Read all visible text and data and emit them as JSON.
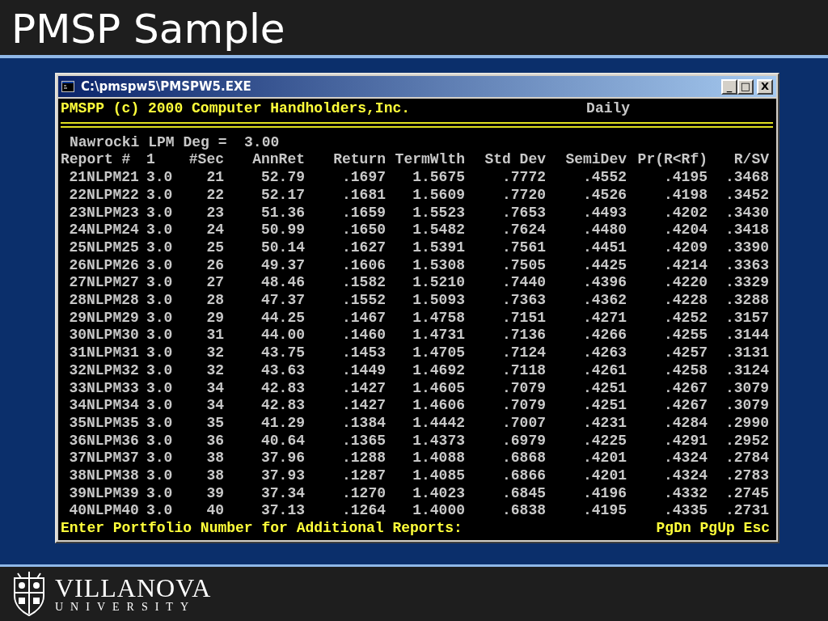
{
  "slide": {
    "title": "PMSP Sample"
  },
  "window": {
    "title": "C:\\pmspw5\\PMSPW5.EXE",
    "buttons": [
      "_",
      "□",
      "X"
    ]
  },
  "console": {
    "banner": "PMSPP (c) 2000 Computer Handholders,Inc.",
    "period": "Daily",
    "parameter": "Nawrocki LPM Deg =  3.00",
    "columns": [
      "Report #",
      "",
      "1",
      "#Sec",
      "AnnRet",
      "Return",
      "TermWlth",
      "Std Dev",
      "SemiDev",
      "Pr(R<Rf)",
      "R/SV"
    ],
    "rows": [
      [
        "21",
        "NLPM21",
        "3.0",
        "21",
        "52.79",
        ".1697",
        "1.5675",
        ".7772",
        ".4552",
        ".4195",
        ".3468"
      ],
      [
        "22",
        "NLPM22",
        "3.0",
        "22",
        "52.17",
        ".1681",
        "1.5609",
        ".7720",
        ".4526",
        ".4198",
        ".3452"
      ],
      [
        "23",
        "NLPM23",
        "3.0",
        "23",
        "51.36",
        ".1659",
        "1.5523",
        ".7653",
        ".4493",
        ".4202",
        ".3430"
      ],
      [
        "24",
        "NLPM24",
        "3.0",
        "24",
        "50.99",
        ".1650",
        "1.5482",
        ".7624",
        ".4480",
        ".4204",
        ".3418"
      ],
      [
        "25",
        "NLPM25",
        "3.0",
        "25",
        "50.14",
        ".1627",
        "1.5391",
        ".7561",
        ".4451",
        ".4209",
        ".3390"
      ],
      [
        "26",
        "NLPM26",
        "3.0",
        "26",
        "49.37",
        ".1606",
        "1.5308",
        ".7505",
        ".4425",
        ".4214",
        ".3363"
      ],
      [
        "27",
        "NLPM27",
        "3.0",
        "27",
        "48.46",
        ".1582",
        "1.5210",
        ".7440",
        ".4396",
        ".4220",
        ".3329"
      ],
      [
        "28",
        "NLPM28",
        "3.0",
        "28",
        "47.37",
        ".1552",
        "1.5093",
        ".7363",
        ".4362",
        ".4228",
        ".3288"
      ],
      [
        "29",
        "NLPM29",
        "3.0",
        "29",
        "44.25",
        ".1467",
        "1.4758",
        ".7151",
        ".4271",
        ".4252",
        ".3157"
      ],
      [
        "30",
        "NLPM30",
        "3.0",
        "31",
        "44.00",
        ".1460",
        "1.4731",
        ".7136",
        ".4266",
        ".4255",
        ".3144"
      ],
      [
        "31",
        "NLPM31",
        "3.0",
        "32",
        "43.75",
        ".1453",
        "1.4705",
        ".7124",
        ".4263",
        ".4257",
        ".3131"
      ],
      [
        "32",
        "NLPM32",
        "3.0",
        "32",
        "43.63",
        ".1449",
        "1.4692",
        ".7118",
        ".4261",
        ".4258",
        ".3124"
      ],
      [
        "33",
        "NLPM33",
        "3.0",
        "34",
        "42.83",
        ".1427",
        "1.4605",
        ".7079",
        ".4251",
        ".4267",
        ".3079"
      ],
      [
        "34",
        "NLPM34",
        "3.0",
        "34",
        "42.83",
        ".1427",
        "1.4606",
        ".7079",
        ".4251",
        ".4267",
        ".3079"
      ],
      [
        "35",
        "NLPM35",
        "3.0",
        "35",
        "41.29",
        ".1384",
        "1.4442",
        ".7007",
        ".4231",
        ".4284",
        ".2990"
      ],
      [
        "36",
        "NLPM36",
        "3.0",
        "36",
        "40.64",
        ".1365",
        "1.4373",
        ".6979",
        ".4225",
        ".4291",
        ".2952"
      ],
      [
        "37",
        "NLPM37",
        "3.0",
        "38",
        "37.96",
        ".1288",
        "1.4088",
        ".6868",
        ".4201",
        ".4324",
        ".2784"
      ],
      [
        "38",
        "NLPM38",
        "3.0",
        "38",
        "37.93",
        ".1287",
        "1.4085",
        ".6866",
        ".4201",
        ".4324",
        ".2783"
      ],
      [
        "39",
        "NLPM39",
        "3.0",
        "39",
        "37.34",
        ".1270",
        "1.4023",
        ".6845",
        ".4196",
        ".4332",
        ".2745"
      ],
      [
        "40",
        "NLPM40",
        "3.0",
        "40",
        "37.13",
        ".1264",
        "1.4000",
        ".6838",
        ".4195",
        ".4335",
        ".2731"
      ]
    ],
    "prompt": "Enter Portfolio Number for Additional Reports:",
    "keys": "PgDn PgUp Esc"
  },
  "footer": {
    "logo_name": "VILLANOVA",
    "logo_sub": "UNIVERSITY"
  }
}
